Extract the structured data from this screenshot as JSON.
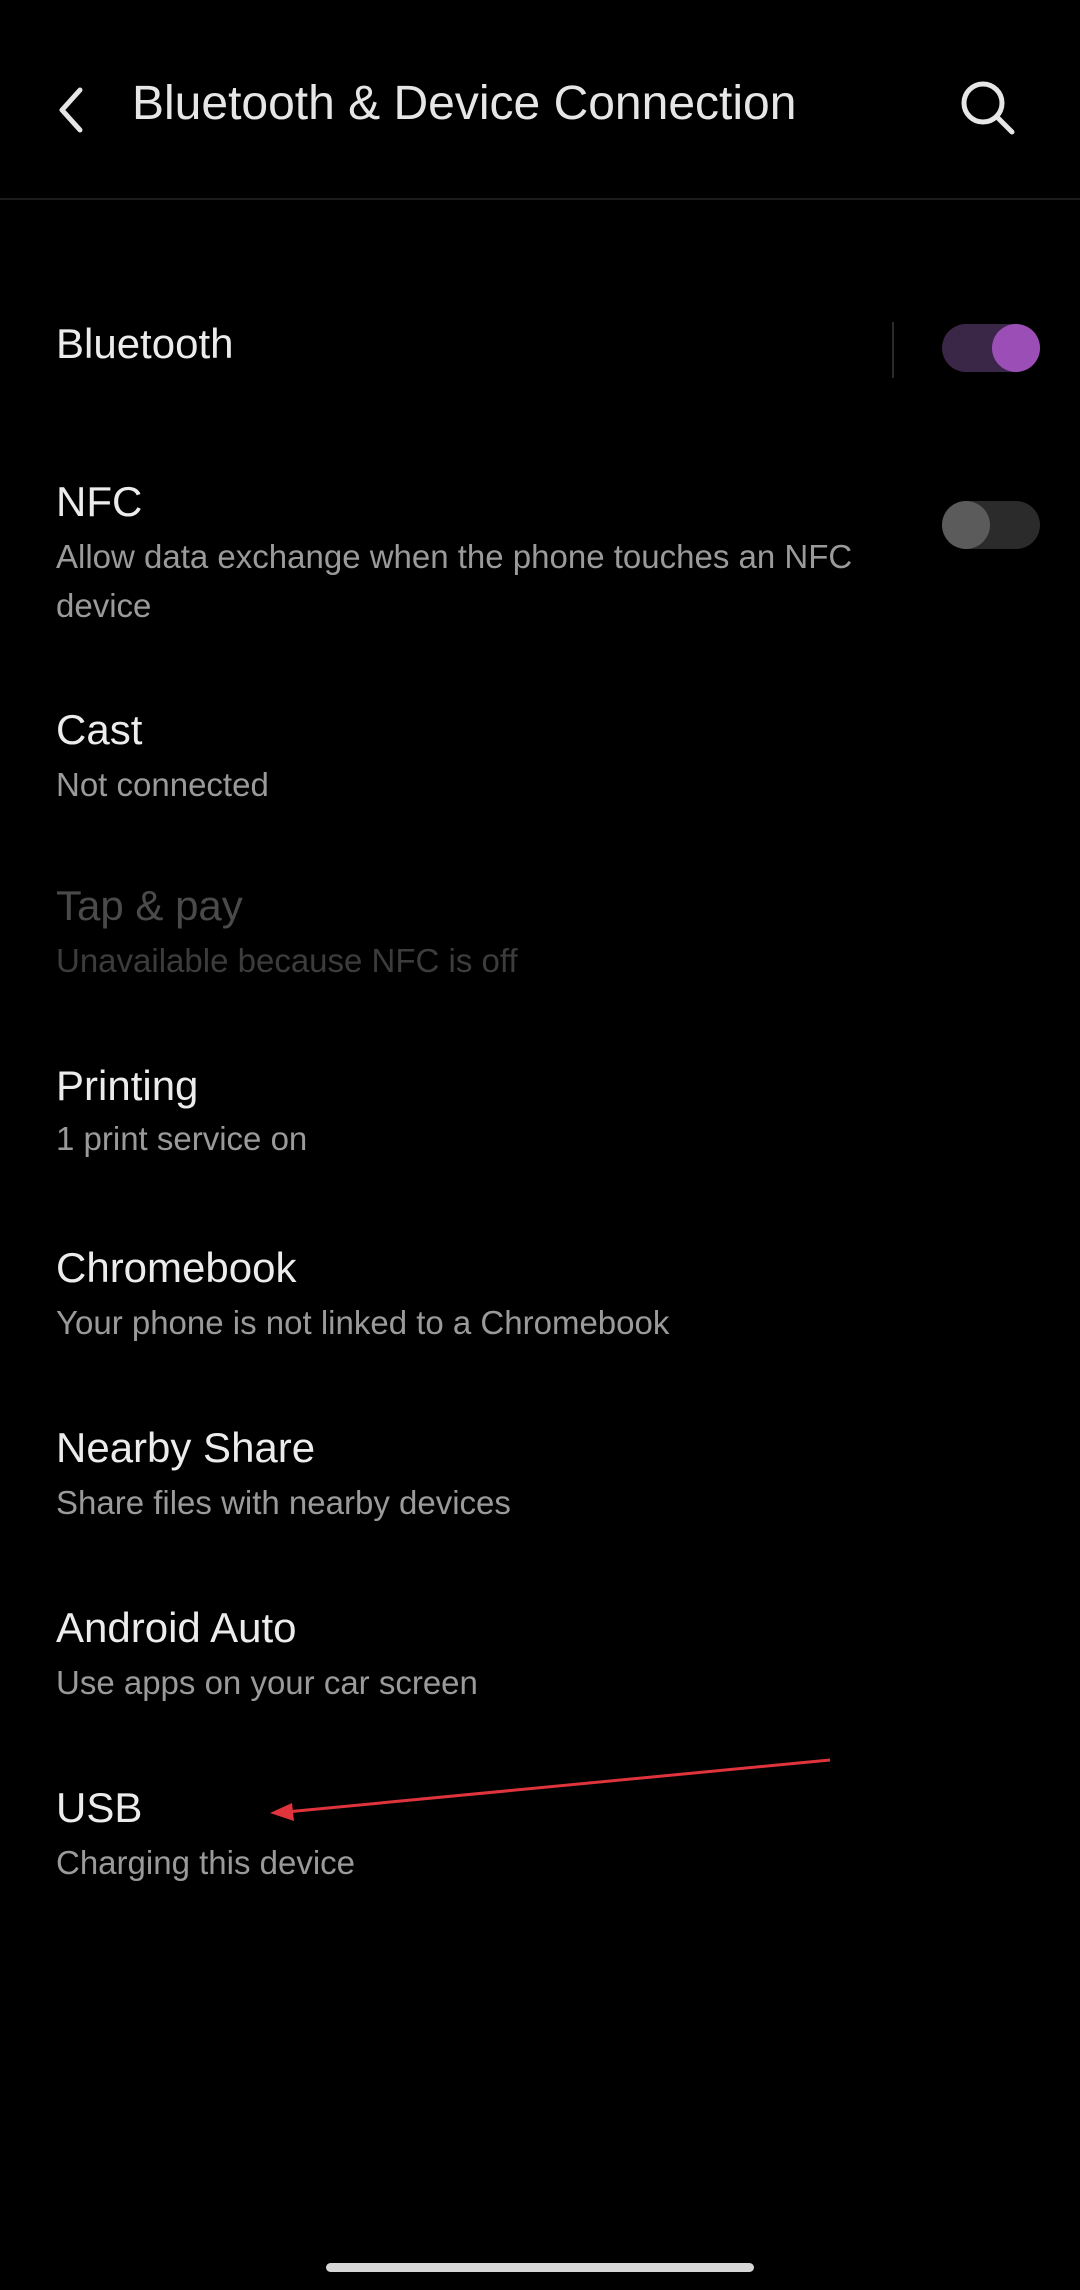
{
  "header": {
    "title": "Bluetooth & Device Connection",
    "back_icon": "chevron-left-icon",
    "search_icon": "search-icon"
  },
  "settings": {
    "bluetooth": {
      "title": "Bluetooth",
      "toggle_on": true
    },
    "nfc": {
      "title": "NFC",
      "subtitle": "Allow data exchange when the phone touches an NFC device",
      "toggle_on": false
    },
    "cast": {
      "title": "Cast",
      "subtitle": "Not connected"
    },
    "tap_pay": {
      "title": "Tap & pay",
      "subtitle": "Unavailable because NFC is off",
      "enabled": false
    },
    "printing": {
      "title": "Printing",
      "subtitle": "1 print service on"
    },
    "chromebook": {
      "title": "Chromebook",
      "subtitle": "Your phone is not linked to a Chromebook"
    },
    "nearby_share": {
      "title": "Nearby Share",
      "subtitle": "Share files with nearby devices"
    },
    "android_auto": {
      "title": "Android Auto",
      "subtitle": "Use apps on your car screen"
    },
    "usb": {
      "title": "USB",
      "subtitle": "Charging this device"
    }
  },
  "colors": {
    "background": "#000000",
    "accent": "#9b4fb6",
    "annotation_arrow": "#e0343c"
  }
}
